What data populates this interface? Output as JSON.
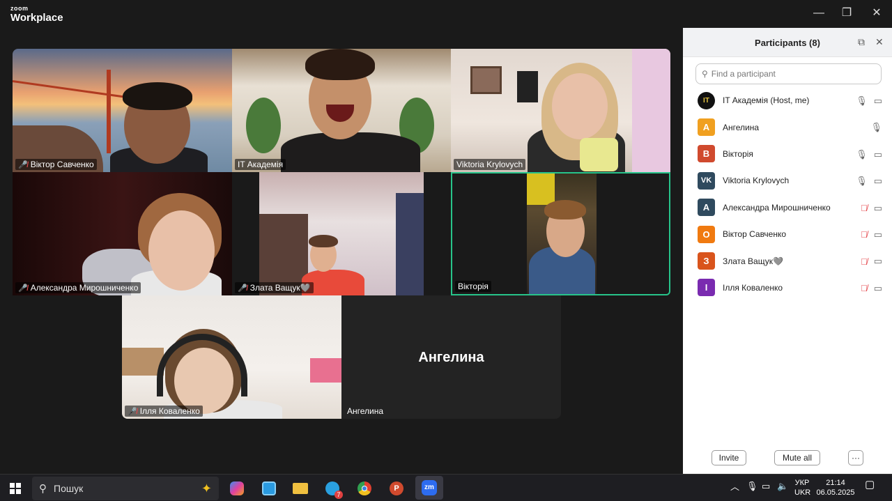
{
  "window": {
    "brand_small": "zoom",
    "brand_big": "Workplace",
    "minimize": "—",
    "restore": "❐",
    "close": "✕"
  },
  "video_tiles": [
    {
      "name": "Віктор Савченко",
      "muted": true
    },
    {
      "name": "IT Академія",
      "muted": false
    },
    {
      "name": "Viktoria Krylovych",
      "muted": false
    },
    {
      "name": "Александра Мирошниченко",
      "muted": true
    },
    {
      "name": "Злата Ващук🩶",
      "muted": true
    },
    {
      "name": "Вікторія",
      "muted": false,
      "active_speaker": true
    },
    {
      "name": "Ілля Коваленко",
      "muted": true
    },
    {
      "name": "Ангелина",
      "muted": false,
      "video_off": true,
      "center_label": "Ангелина"
    }
  ],
  "panel": {
    "title": "Participants (8)",
    "search_placeholder": "Find a participant",
    "invite": "Invite",
    "mute_all": "Mute all",
    "more": "···",
    "participants": [
      {
        "initial": "IT",
        "name": "IT Академія (Host, me)",
        "color": "#111111",
        "mic": "on",
        "cam": "on"
      },
      {
        "initial": "А",
        "name": "Ангелина",
        "color": "#f0a020",
        "mic": "on",
        "cam": "none"
      },
      {
        "initial": "В",
        "name": "Вікторія",
        "color": "#d04a2e",
        "mic": "on",
        "cam": "on"
      },
      {
        "initial": "VK",
        "name": "Viktoria Krylovych",
        "color": "#2f4a5e",
        "mic": "on",
        "cam": "on"
      },
      {
        "initial": "А",
        "name": "Александра Мирошниченко",
        "color": "#2f4a5e",
        "mic": "muted",
        "cam": "on"
      },
      {
        "initial": "О",
        "name": "Віктор Савченко",
        "color": "#f07a10",
        "mic": "muted",
        "cam": "on"
      },
      {
        "initial": "З",
        "name": "Злата Ващук🩶",
        "color": "#d9541c",
        "mic": "muted",
        "cam": "on"
      },
      {
        "initial": "І",
        "name": "Ілля Коваленко",
        "color": "#7a2bb0",
        "mic": "muted",
        "cam": "on"
      }
    ]
  },
  "taskbar": {
    "search_label": "Пошук",
    "lang_top": "УКР",
    "lang_bottom": "UKR",
    "time": "21:14",
    "date": "06.05.2025",
    "telegram_badge": "7",
    "zoom_label": "zm"
  }
}
